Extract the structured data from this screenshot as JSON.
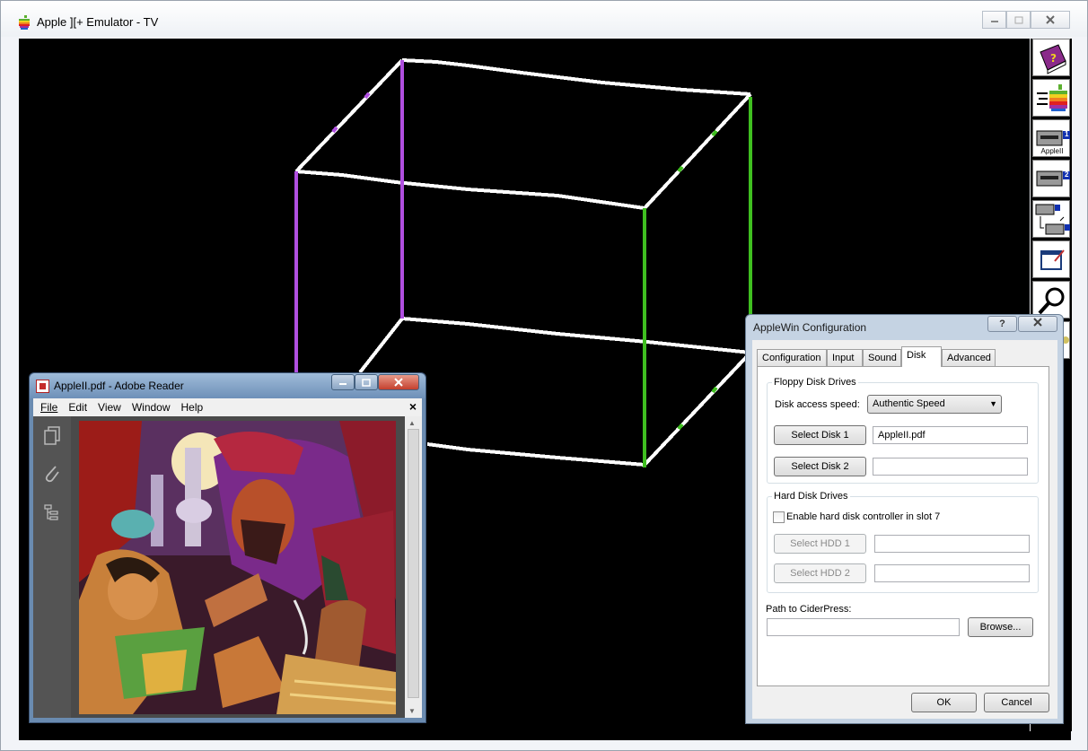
{
  "main_window": {
    "title": "Apple ][+ Emulator - TV"
  },
  "toolbar": {
    "disk1_caption": "AppleII",
    "disk1_num": "1",
    "disk2_num": "2"
  },
  "reader": {
    "title": "AppleII.pdf - Adobe Reader",
    "menu": [
      "File",
      "Edit",
      "View",
      "Window",
      "Help"
    ],
    "close_doc": "×"
  },
  "dialog": {
    "title": "AppleWin Configuration",
    "help": "?",
    "tabs": [
      "Configuration",
      "Input",
      "Sound",
      "Disk",
      "Advanced"
    ],
    "active_tab": "Disk",
    "floppy": {
      "group_label": "Floppy Disk Drives",
      "speed_label": "Disk access speed:",
      "speed_value": "Authentic Speed",
      "select_disk1": "Select Disk 1",
      "disk1_value": "AppleII.pdf",
      "select_disk2": "Select Disk 2",
      "disk2_value": ""
    },
    "hdd": {
      "group_label": "Hard Disk Drives",
      "enable_label": "Enable hard disk controller in slot 7",
      "enabled": false,
      "select_hdd1": "Select HDD 1",
      "hdd1_value": "",
      "select_hdd2": "Select HDD 2",
      "hdd2_value": ""
    },
    "ciderpress": {
      "label": "Path to CiderPress:",
      "value": "",
      "browse": "Browse..."
    },
    "ok": "OK",
    "cancel": "Cancel"
  },
  "colors": {
    "purple": "#b04fe0",
    "green": "#3fbf20",
    "white": "#ffffff",
    "screen_bg": "#000000"
  }
}
